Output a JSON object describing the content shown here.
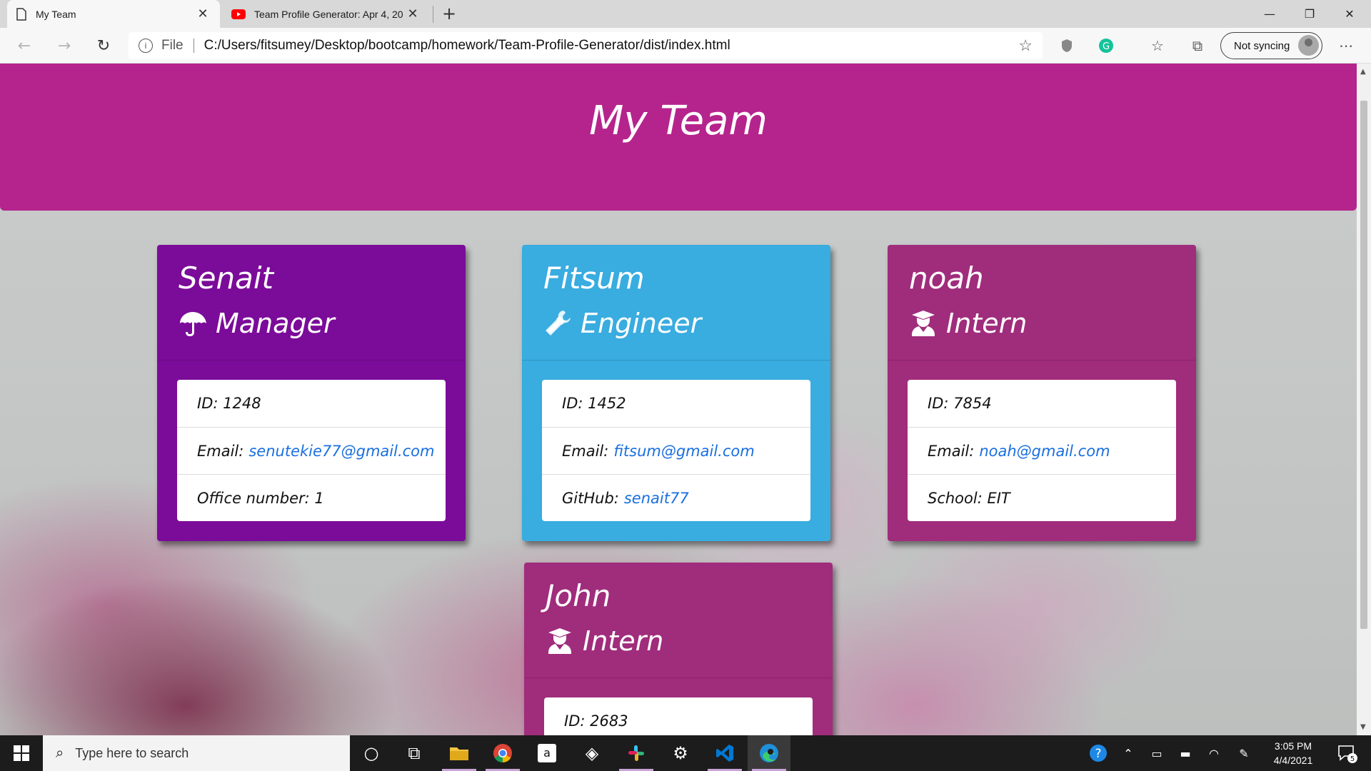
{
  "browser": {
    "tabs": [
      {
        "title": "My Team",
        "active": true
      },
      {
        "title": "Team Profile Generator: Apr 4, 20",
        "active": false
      }
    ],
    "address": {
      "scheme_label": "File",
      "url": "C:/Users/fitsumey/Desktop/bootcamp/homework/Team-Profile-Generator/dist/index.html"
    },
    "profile_label": "Not syncing"
  },
  "page": {
    "title": "My Team",
    "colors": {
      "header": "#b5248c",
      "manager": "#7b0b99",
      "engineer": "#39ace0",
      "intern": "#a02c7c",
      "link": "#1a6fe0"
    },
    "cards": [
      {
        "name": "Senait",
        "role": "Manager",
        "icon": "umbrella-icon",
        "id_label": "ID: 1248",
        "email_label": "Email:",
        "email": "senutekie77@gmail.com",
        "extra_label": "Office number: 1"
      },
      {
        "name": "Fitsum",
        "role": "Engineer",
        "icon": "tools-icon",
        "id_label": "ID: 1452",
        "email_label": "Email:",
        "email": "fitsum@gmail.com",
        "extra_label": "GitHub:",
        "extra_link": "senait77"
      },
      {
        "name": "noah",
        "role": "Intern",
        "icon": "graduate-icon",
        "id_label": "ID: 7854",
        "email_label": "Email:",
        "email": "noah@gmail.com",
        "extra_label": "School: EIT"
      },
      {
        "name": "John",
        "role": "Intern",
        "icon": "graduate-icon",
        "id_label": "ID: 2683"
      }
    ]
  },
  "taskbar": {
    "search_placeholder": "Type here to search",
    "time": "3:05 PM",
    "date": "4/4/2021",
    "notification_count": "5",
    "apps": [
      "cortana-icon",
      "task-view-icon",
      "file-explorer-icon",
      "chrome-icon",
      "amazon-icon",
      "dropbox-icon",
      "slack-icon",
      "settings-icon",
      "vscode-icon",
      "edge-icon"
    ]
  }
}
